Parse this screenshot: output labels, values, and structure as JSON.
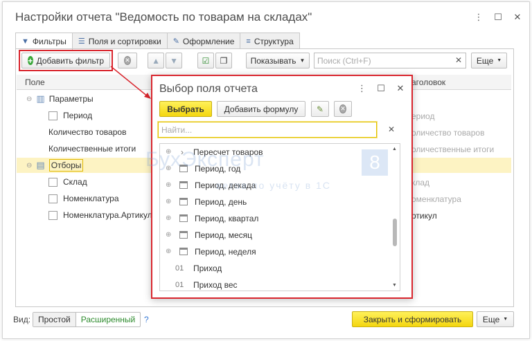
{
  "window": {
    "title": "Настройки отчета \"Ведомость по товарам на складах\"",
    "more_icon": "⋮",
    "maximize_icon": "☐",
    "close_icon": "✕"
  },
  "tabs": [
    {
      "label": "Фильтры",
      "icon": "▼"
    },
    {
      "label": "Поля и сортировки",
      "icon": "☰"
    },
    {
      "label": "Оформление",
      "icon": "✎"
    },
    {
      "label": "Структура",
      "icon": "≡"
    }
  ],
  "toolbar": {
    "add_filter": "Добавить фильтр",
    "show": "Показывать",
    "search_placeholder": "Поиск (Ctrl+F)",
    "more": "Еще"
  },
  "grid": {
    "col_field": "Поле",
    "col_header": "аголовок",
    "rows": [
      {
        "label": "Параметры",
        "right": ""
      },
      {
        "label": "Период",
        "right": "ериод"
      },
      {
        "label": "Количество товаров",
        "right": "оличество товаров"
      },
      {
        "label": "Количественные итоги",
        "right": "оличественные итоги"
      },
      {
        "label": "Отборы",
        "right": ""
      },
      {
        "label": "Склад",
        "right": "клад"
      },
      {
        "label": "Номенклатура",
        "right": "оменклатура"
      },
      {
        "label": "Номенклатура.Артикул",
        "right": "ртикул"
      }
    ]
  },
  "dialog": {
    "title": "Выбор поля отчета",
    "choose": "Выбрать",
    "add_formula": "Добавить формулу",
    "find_placeholder": "Найти...",
    "items": [
      {
        "label": "Пересчет товаров",
        "kind": "folder"
      },
      {
        "label": "Период, год",
        "kind": "date"
      },
      {
        "label": "Период, декада",
        "kind": "date"
      },
      {
        "label": "Период, день",
        "kind": "date"
      },
      {
        "label": "Период, квартал",
        "kind": "date"
      },
      {
        "label": "Период, месяц",
        "kind": "date"
      },
      {
        "label": "Период, неделя",
        "kind": "date"
      },
      {
        "label": "Приход",
        "kind": "number",
        "num": "01"
      },
      {
        "label": "Приход вес",
        "kind": "number",
        "num": "01"
      }
    ]
  },
  "watermark": {
    "brand": "БухЭксперт",
    "digit": "8",
    "tagline": "ветов по учёту в 1С"
  },
  "footer": {
    "view_label": "Вид:",
    "simple": "Простой",
    "extended": "Расширенный",
    "help": "?",
    "close_build": "Закрыть и сформировать",
    "more": "Еще"
  },
  "colors": {
    "accent_yellow": "#f4d60f",
    "highlight_red": "#d9252d",
    "row_highlight": "#fdf3c3"
  }
}
